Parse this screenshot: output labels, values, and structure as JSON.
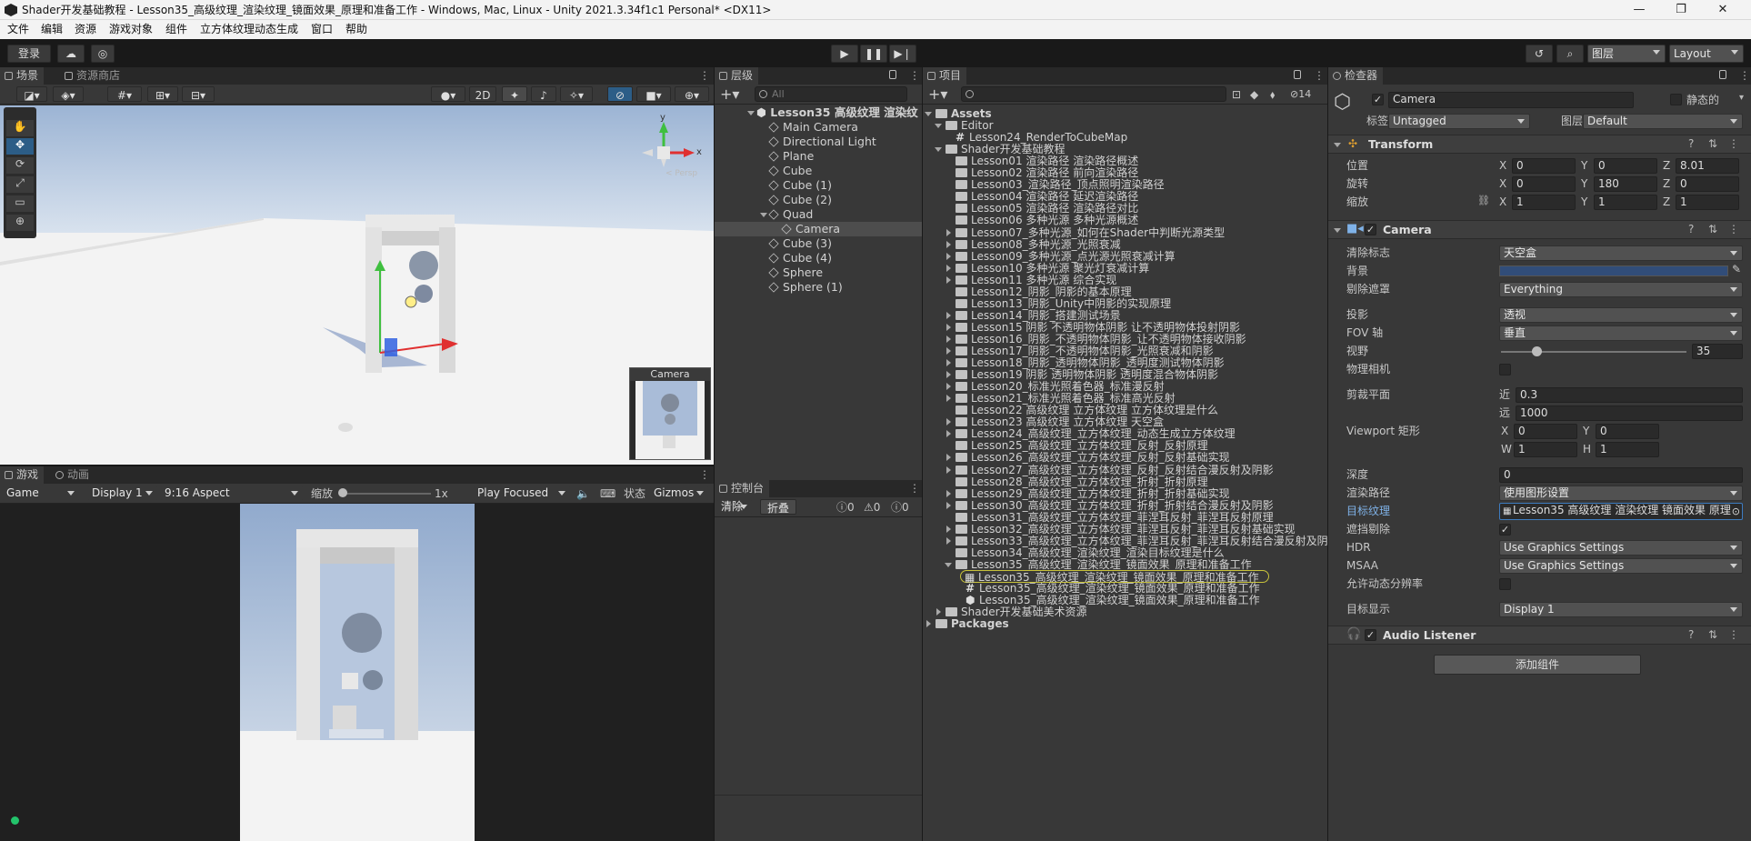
{
  "title_bar": {
    "title": "Shader开发基础教程 - Lesson35_高级纹理_渲染纹理_镜面效果_原理和准备工作 - Windows, Mac, Linux - Unity 2021.3.34f1c1 Personal* <DX11>",
    "minimize": "—",
    "maximize": "❐",
    "close": "✕"
  },
  "menu": [
    "文件",
    "编辑",
    "资源",
    "游戏对象",
    "组件",
    "立方体纹理动态生成",
    "窗口",
    "帮助"
  ],
  "toolbar": {
    "login": "登录",
    "layers": "图层",
    "layout": "Layout"
  },
  "scene": {
    "tabs": [
      "场景",
      "资源商店"
    ],
    "toggle_2d": "2D",
    "gizmo_persp": "< Persp",
    "gizmo_axes": [
      "y",
      "x",
      "z"
    ],
    "camera_preview_title": "Camera"
  },
  "game": {
    "tabs": [
      "游戏",
      "动画"
    ],
    "mode": "Game",
    "display": "Display 1",
    "aspect": "9:16 Aspect",
    "scale_label": "缩放",
    "scale_value": "1x",
    "play_focus": "Play Focused",
    "stats": "状态",
    "gizmos": "Gizmos"
  },
  "hierarchy": {
    "tab": "层级",
    "search_placeholder": "All",
    "scene_name": "Lesson35 高级纹理 渲染纹",
    "items": [
      {
        "name": "Main Camera",
        "depth": 1
      },
      {
        "name": "Directional Light",
        "depth": 1
      },
      {
        "name": "Plane",
        "depth": 1
      },
      {
        "name": "Cube",
        "depth": 1
      },
      {
        "name": "Cube (1)",
        "depth": 1
      },
      {
        "name": "Cube (2)",
        "depth": 1
      },
      {
        "name": "Quad",
        "depth": 1
      },
      {
        "name": "Camera",
        "depth": 2,
        "selected": true
      },
      {
        "name": "Cube (3)",
        "depth": 1
      },
      {
        "name": "Cube (4)",
        "depth": 1
      },
      {
        "name": "Sphere",
        "depth": 1
      },
      {
        "name": "Sphere (1)",
        "depth": 1
      }
    ]
  },
  "console": {
    "tab": "控制台",
    "clear": "清除",
    "collapse": "折叠",
    "counts": [
      "0",
      "0",
      "0"
    ]
  },
  "project": {
    "tab": "项目",
    "hidden_count": "14",
    "items": [
      {
        "name": "Assets",
        "depth": 0,
        "bold": true,
        "expand": "open"
      },
      {
        "name": "Editor",
        "depth": 1,
        "expand": "open"
      },
      {
        "name": "Lesson24_RenderToCubeMap",
        "depth": 2,
        "kind": "script"
      },
      {
        "name": "Shader开发基础教程",
        "depth": 1,
        "expand": "open"
      },
      {
        "name": "Lesson01 渲染路径 渲染路径概述",
        "depth": 2
      },
      {
        "name": "Lesson02 渲染路径 前向渲染路径",
        "depth": 2
      },
      {
        "name": "Lesson03_渲染路径_顶点照明渲染路径",
        "depth": 2
      },
      {
        "name": "Lesson04 渲染路径 延迟渲染路径",
        "depth": 2
      },
      {
        "name": "Lesson05 渲染路径 渲染路径对比",
        "depth": 2
      },
      {
        "name": "Lesson06 多种光源 多种光源概述",
        "depth": 2
      },
      {
        "name": "Lesson07_多种光源_如何在Shader中判断光源类型",
        "depth": 2,
        "expand": "closed"
      },
      {
        "name": "Lesson08_多种光源_光照衰减",
        "depth": 2,
        "expand": "closed"
      },
      {
        "name": "Lesson09_多种光源_点光源光照衰减计算",
        "depth": 2,
        "expand": "closed"
      },
      {
        "name": "Lesson10 多种光源 聚光灯衰减计算",
        "depth": 2,
        "expand": "closed"
      },
      {
        "name": "Lesson11 多种光源 综合实现",
        "depth": 2,
        "expand": "closed"
      },
      {
        "name": "Lesson12_阴影_阴影的基本原理",
        "depth": 2
      },
      {
        "name": "Lesson13_阴影_Unity中阴影的实现原理",
        "depth": 2
      },
      {
        "name": "Lesson14_阴影_搭建测试场景",
        "depth": 2,
        "expand": "closed"
      },
      {
        "name": "Lesson15 阴影 不透明物体阴影 让不透明物体投射阴影",
        "depth": 2,
        "expand": "closed"
      },
      {
        "name": "Lesson16_阴影_不透明物体阴影_让不透明物体接收阴影",
        "depth": 2,
        "expand": "closed"
      },
      {
        "name": "Lesson17_阴影_不透明物体阴影_光照衰减和阴影",
        "depth": 2,
        "expand": "closed"
      },
      {
        "name": "Lesson18_阴影_透明物体阴影_透明度测试物体阴影",
        "depth": 2,
        "expand": "closed"
      },
      {
        "name": "Lesson19 阴影 透明物体阴影 透明度混合物体阴影",
        "depth": 2,
        "expand": "closed"
      },
      {
        "name": "Lesson20_标准光照着色器_标准漫反射",
        "depth": 2,
        "expand": "closed"
      },
      {
        "name": "Lesson21_标准光照着色器_标准高光反射",
        "depth": 2,
        "expand": "closed"
      },
      {
        "name": "Lesson22 高级纹理 立方体纹理 立方体纹理是什么",
        "depth": 2
      },
      {
        "name": "Lesson23 高级纹理 立方体纹理 天空盒",
        "depth": 2,
        "expand": "closed"
      },
      {
        "name": "Lesson24_高级纹理_立方体纹理_动态生成立方体纹理",
        "depth": 2,
        "expand": "closed"
      },
      {
        "name": "Lesson25_高级纹理_立方体纹理_反射_反射原理",
        "depth": 2
      },
      {
        "name": "Lesson26_高级纹理_立方体纹理_反射_反射基础实现",
        "depth": 2,
        "expand": "closed"
      },
      {
        "name": "Lesson27_高级纹理_立方体纹理_反射_反射结合漫反射及阴影",
        "depth": 2,
        "expand": "closed"
      },
      {
        "name": "Lesson28_高级纹理_立方体纹理_折射_折射原理",
        "depth": 2
      },
      {
        "name": "Lesson29_高级纹理_立方体纹理_折射_折射基础实现",
        "depth": 2,
        "expand": "closed"
      },
      {
        "name": "Lesson30_高级纹理_立方体纹理_折射_折射结合漫反射及阴影",
        "depth": 2,
        "expand": "closed"
      },
      {
        "name": "Lesson31_高级纹理_立方体纹理_菲涅耳反射_菲涅耳反射原理",
        "depth": 2
      },
      {
        "name": "Lesson32_高级纹理_立方体纹理_菲涅耳反射_菲涅耳反射基础实现",
        "depth": 2,
        "expand": "closed"
      },
      {
        "name": "Lesson33_高级纹理_立方体纹理_菲涅耳反射_菲涅耳反射结合漫反射及阴",
        "depth": 2,
        "expand": "closed"
      },
      {
        "name": "Lesson34_高级纹理_渲染纹理_渲染目标纹理是什么",
        "depth": 2
      },
      {
        "name": "Lesson35_高级纹理_渲染纹理_镜面效果_原理和准备工作",
        "depth": 2,
        "expand": "open"
      },
      {
        "name": "Lesson35_高级纹理_渲染纹理_镜面效果_原理和准备工作",
        "depth": 3,
        "kind": "rendertexture",
        "highlight": true
      },
      {
        "name": "Lesson35_高级纹理_渲染纹理_镜面效果_原理和准备工作",
        "depth": 3,
        "kind": "script"
      },
      {
        "name": "Lesson35_高级纹理_渲染纹理_镜面效果_原理和准备工作",
        "depth": 3,
        "kind": "scene"
      },
      {
        "name": "Shader开发基础美术资源",
        "depth": 1,
        "expand": "closed"
      },
      {
        "name": "Packages",
        "depth": 0,
        "bold": true,
        "expand": "closed"
      }
    ]
  },
  "inspector": {
    "tab": "检查器",
    "object_name": "Camera",
    "static_label": "静态的",
    "tag_label": "标签",
    "tag_value": "Untagged",
    "layer_label": "图层",
    "layer_value": "Default",
    "transform": {
      "title": "Transform",
      "position_label": "位置",
      "position": [
        "0",
        "0",
        "8.01"
      ],
      "rotation_label": "旋转",
      "rotation": [
        "0",
        "180",
        "0"
      ],
      "scale_label": "缩放",
      "scale": [
        "1",
        "1",
        "1"
      ],
      "axes": [
        "X",
        "Y",
        "Z"
      ]
    },
    "camera": {
      "title": "Camera",
      "clear_flags_label": "清除标志",
      "clear_flags": "天空盒",
      "background_label": "背景",
      "background_color": "#314d79",
      "culling_mask_label": "剔除遮罩",
      "culling_mask": "Everything",
      "projection_label": "投影",
      "projection": "透视",
      "fov_axis_label": "FOV 轴",
      "fov_axis": "垂直",
      "fov_label": "视野",
      "fov": "35",
      "fov_fraction": 0.19,
      "physical_label": "物理相机",
      "clipping_label": "剪裁平面",
      "near_label": "近",
      "near": "0.3",
      "far_label": "远",
      "far": "1000",
      "viewport_label": "Viewport 矩形",
      "viewport_x": "0",
      "viewport_y": "0",
      "viewport_w": "1",
      "viewport_h": "1",
      "vp_x_lbl": "X",
      "vp_y_lbl": "Y",
      "vp_w_lbl": "W",
      "vp_h_lbl": "H",
      "depth_label": "深度",
      "depth": "0",
      "render_path_label": "渲染路径",
      "render_path": "使用图形设置",
      "target_texture_label": "目标纹理",
      "target_texture": "Lesson35 高级纹理 渲染纹理 镜面效果 原理",
      "occlusion_label": "遮挡剔除",
      "occlusion_check": "✓",
      "hdr_label": "HDR",
      "hdr": "Use Graphics Settings",
      "msaa_label": "MSAA",
      "msaa": "Use Graphics Settings",
      "dynres_label": "允许动态分辨率",
      "target_display_label": "目标显示",
      "target_display": "Display 1"
    },
    "audio_listener": "Audio Listener",
    "add_component": "添加组件"
  },
  "colors": {
    "accent": "#2c5d87",
    "sky": "#9fb6d6",
    "selection": "#4d4d4d",
    "highlight_outline": "#c8c23a"
  }
}
